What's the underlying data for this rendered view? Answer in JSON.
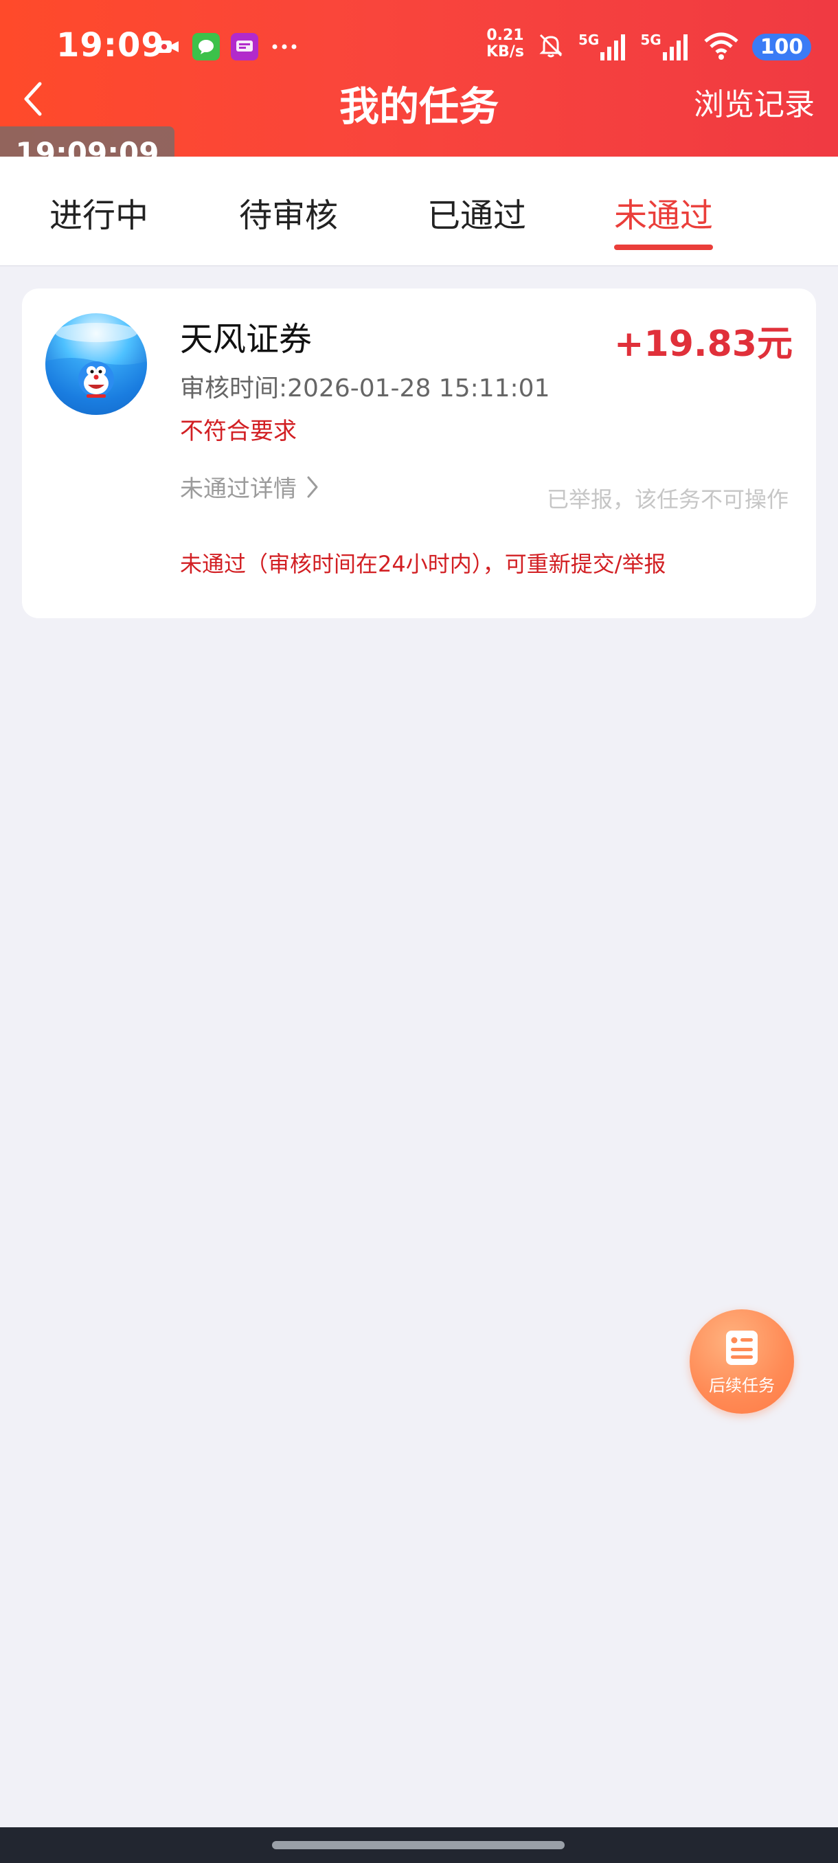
{
  "status_bar": {
    "time": "19:09",
    "net_speed_value": "0.21",
    "net_speed_unit": "KB/s",
    "signal1_label": "5G",
    "signal2_label": "5G",
    "battery": "100"
  },
  "header": {
    "title": "我的任务",
    "history_link": "浏览记录"
  },
  "time_overlay": "19:09:09",
  "tabs": [
    {
      "label": "进行中",
      "active": false
    },
    {
      "label": "待审核",
      "active": false
    },
    {
      "label": "已通过",
      "active": false
    },
    {
      "label": "未通过",
      "active": true
    }
  ],
  "task_card": {
    "name": "天风证券",
    "reward": "+19.83元",
    "review_time": "审核时间:2026-01-28 15:11:01",
    "fail_reason": "不符合要求",
    "fail_detail_link": "未通过详情",
    "reported_note": "已举报，该任务不可操作",
    "resubmit_note": "未通过（审核时间在24小时内），可重新提交/举报"
  },
  "float_button": {
    "label": "后续任务",
    "icon": "document-list-icon"
  },
  "colors": {
    "header_start": "#ff4a2a",
    "header_end": "#f03a42",
    "accent_red": "#ea3e3a",
    "error_red": "#d21f23",
    "page_bg": "#f1f1f7",
    "float_button": "#ff8a55"
  }
}
